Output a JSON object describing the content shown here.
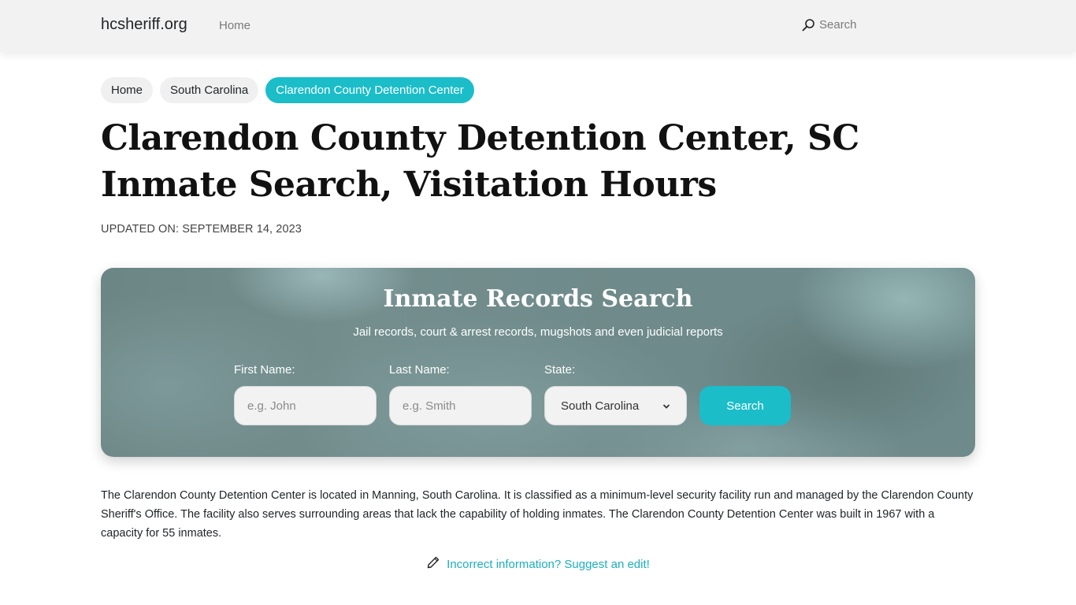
{
  "navbar": {
    "brand": "hcsheriff.org",
    "links": [
      {
        "label": "Home"
      }
    ],
    "search_label": "Search",
    "search_icon": "search-icon"
  },
  "breadcrumb": [
    {
      "label": "Home",
      "active": false
    },
    {
      "label": "South Carolina",
      "active": false
    },
    {
      "label": "Clarendon County Detention Center",
      "active": true
    }
  ],
  "page": {
    "title": "Clarendon County Detention Center, SC Inmate Search, Visitation Hours",
    "updated": "UPDATED ON: SEPTEMBER 14, 2023"
  },
  "search_banner": {
    "title": "Inmate Records Search",
    "subtitle": "Jail records, court & arrest records, mugshots and even judicial reports",
    "first_name": {
      "label": "First Name:",
      "placeholder": "e.g. John",
      "value": ""
    },
    "last_name": {
      "label": "Last Name:",
      "placeholder": "e.g. Smith",
      "value": ""
    },
    "state": {
      "label": "State:",
      "selected": "South Carolina"
    },
    "button_label": "Search"
  },
  "description": "The Clarendon County Detention Center is located in Manning, South Carolina. It is classified as a minimum-level security facility run and managed by the Clarendon County Sheriff's Office. The facility also serves surrounding areas that lack the capability of holding inmates. The Clarendon County Detention Center was built in 1967 with a capacity for 55 inmates.",
  "suggest_edit": {
    "icon": "pencil-icon",
    "label": "Incorrect information? Suggest an edit!"
  },
  "colors": {
    "accent": "#1bbdc9",
    "navbar_bg": "#f2f2f2",
    "crumb_bg": "#f0f0f0",
    "link": "#1bb0bd"
  }
}
